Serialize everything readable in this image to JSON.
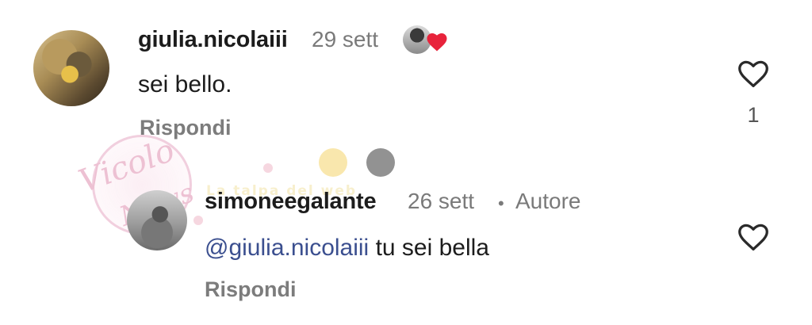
{
  "comments": [
    {
      "username": "giulia.nicolaiii",
      "time": "29 sett",
      "text": "sei bello.",
      "reply_label": "Rispondi",
      "like_count": "1",
      "liked_by_author": true
    },
    {
      "username": "simoneegalante",
      "time": "26 sett",
      "separator": "•",
      "role": "Autore",
      "mention": "@giulia.nicolaiii",
      "text": "tu sei bella",
      "reply_label": "Rispondi"
    }
  ],
  "watermark": {
    "brand": "Vicolo delle News",
    "tagline": "La talpa del web"
  },
  "colors": {
    "text": "#1c1c1c",
    "meta": "#7a7a7a",
    "mention": "#3b4f8f",
    "heart_red": "#e8233b"
  },
  "icons": {
    "like": "heart-outline-icon",
    "author_like": "heart-filled-icon"
  }
}
